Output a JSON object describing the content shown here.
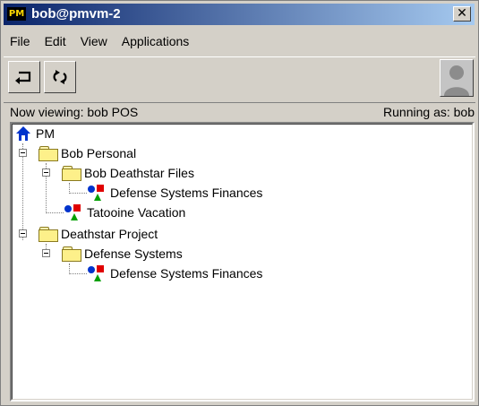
{
  "window": {
    "app_badge": "PM",
    "title": "bob@pmvm-2",
    "close_glyph": "✕"
  },
  "menu": [
    "File",
    "Edit",
    "View",
    "Applications"
  ],
  "toolbar": {
    "buttons": [
      {
        "name": "return-arrow-icon"
      },
      {
        "name": "refresh-icon"
      }
    ],
    "avatar_icon": "user-silhouette-icon"
  },
  "status": {
    "left": "Now viewing: bob POS",
    "right": "Running as: bob"
  },
  "tree": {
    "root": "PM",
    "items": [
      "Bob Personal",
      "Bob Deathstar Files",
      "Defense Systems Finances",
      "Tatooine Vacation",
      "Deathstar Project",
      "Defense Systems",
      "Defense Systems Finances"
    ]
  },
  "colors": {
    "titlebar_start": "#0a246a",
    "titlebar_end": "#a6caf0",
    "chrome": "#d4d0c8",
    "folder": "#fdf08a",
    "obj_blue": "#0033cc",
    "obj_red": "#e00000",
    "obj_green": "#00a000"
  }
}
